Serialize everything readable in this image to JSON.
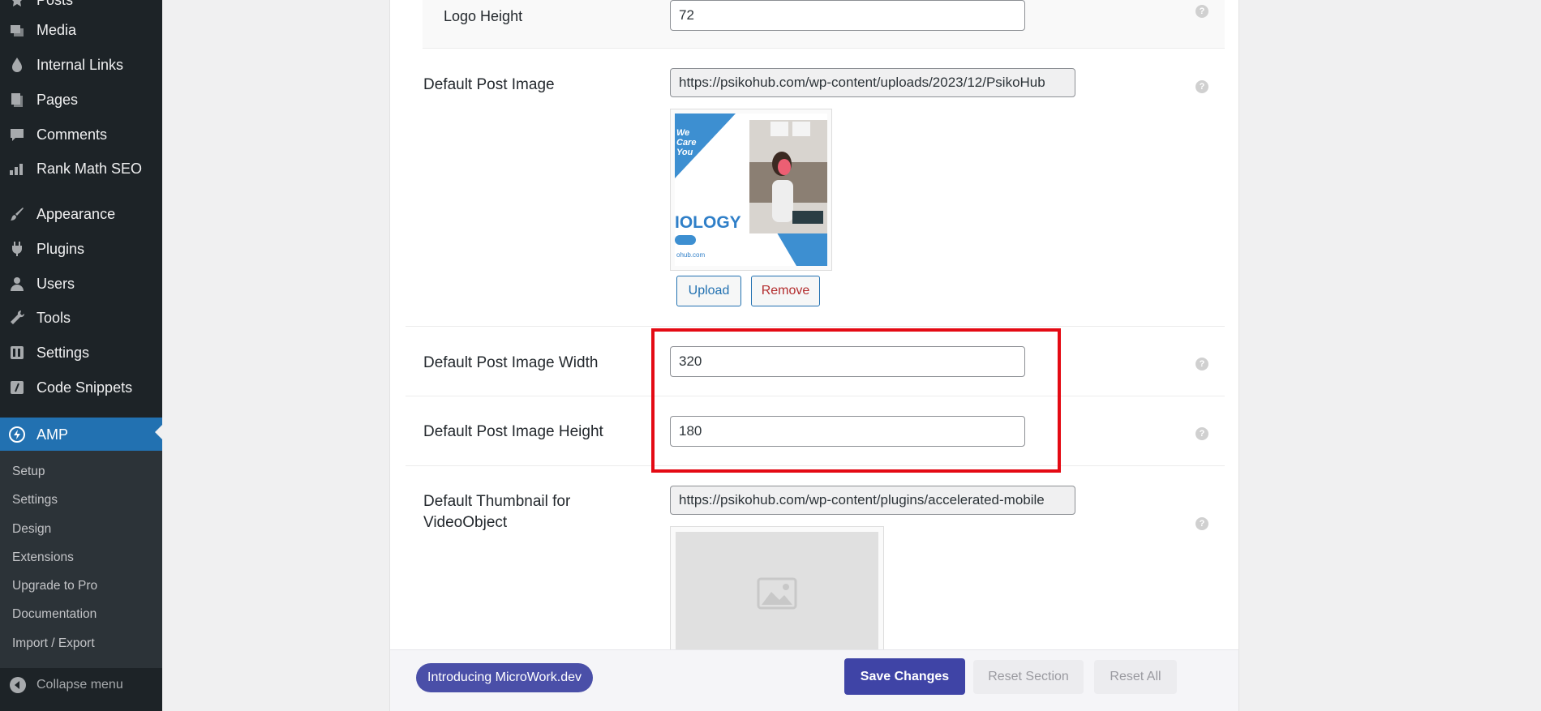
{
  "sidebar": {
    "items": [
      {
        "label": "Posts",
        "icon": "pin-icon"
      },
      {
        "label": "Media",
        "icon": "media-icon"
      },
      {
        "label": "Internal Links",
        "icon": "links-icon"
      },
      {
        "label": "Pages",
        "icon": "pages-icon"
      },
      {
        "label": "Comments",
        "icon": "comments-icon"
      },
      {
        "label": "Rank Math SEO",
        "icon": "chart-icon"
      },
      {
        "label": "Appearance",
        "icon": "brush-icon"
      },
      {
        "label": "Plugins",
        "icon": "plugin-icon"
      },
      {
        "label": "Users",
        "icon": "user-icon"
      },
      {
        "label": "Tools",
        "icon": "wrench-icon"
      },
      {
        "label": "Settings",
        "icon": "settings-icon"
      },
      {
        "label": "Code Snippets",
        "icon": "code-icon"
      }
    ],
    "active": {
      "label": "AMP",
      "icon": "amp-icon"
    },
    "submenu": [
      "Setup",
      "Settings",
      "Design",
      "Extensions",
      "Upgrade to Pro",
      "Documentation",
      "Import / Export"
    ],
    "collapse_label": "Collapse menu"
  },
  "form": {
    "logo_height": {
      "label": "Logo Height",
      "value": "72"
    },
    "default_post_image": {
      "label": "Default Post Image",
      "url": "https://psikohub.com/wp-content/uploads/2023/12/PsikoHub",
      "upload_label": "Upload",
      "remove_label": "Remove",
      "thumb_text_1": "We",
      "thumb_text_2": "Care",
      "thumb_text_3": "You",
      "thumb_text_4": "IOLOGY",
      "thumb_text_5": "ohub.com"
    },
    "width": {
      "label": "Default Post Image Width",
      "value": "320"
    },
    "height": {
      "label": "Default Post Image Height",
      "value": "180"
    },
    "video_thumb": {
      "label_line1": "Default Thumbnail for",
      "label_line2": "VideoObject",
      "url": "https://psikohub.com/wp-content/plugins/accelerated-mobile"
    },
    "help_glyph": "?"
  },
  "footer": {
    "promo": "Introducing MicroWork.dev",
    "save": "Save Changes",
    "reset_section": "Reset Section",
    "reset_all": "Reset All"
  },
  "colors": {
    "sidebar_bg": "#1d2327",
    "accent": "#2271b1",
    "highlight": "#e40a14",
    "save_button": "#3f44a6"
  }
}
